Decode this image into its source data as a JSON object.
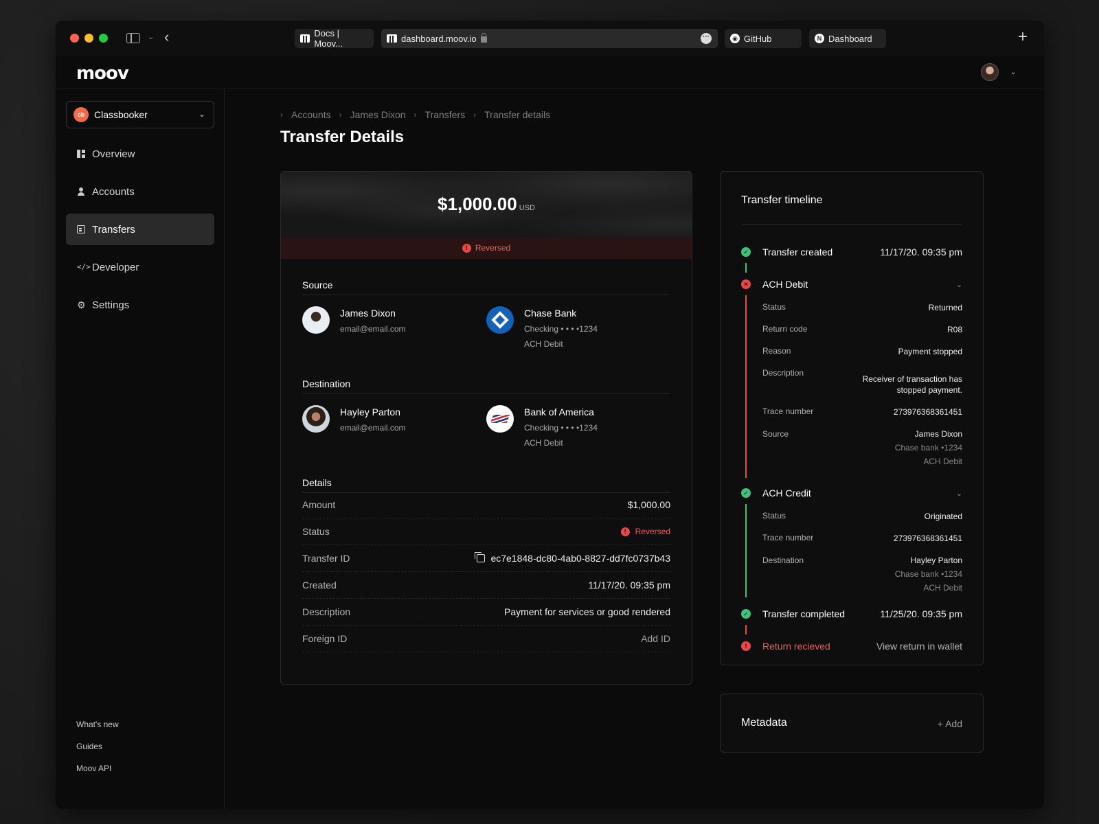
{
  "browser": {
    "tabs": [
      {
        "label": "Docs | Moov..."
      },
      {
        "label": "dashboard.moov.io"
      },
      {
        "label": "GitHub"
      },
      {
        "label": "Dashboard"
      }
    ]
  },
  "app": {
    "logo": "moov"
  },
  "sidebar": {
    "org": {
      "badge": "cb",
      "name": "Classbooker"
    },
    "items": [
      {
        "label": "Overview",
        "icon": "grid-icon"
      },
      {
        "label": "Accounts",
        "icon": "user-icon"
      },
      {
        "label": "Transfers",
        "icon": "document-icon",
        "active": true
      },
      {
        "label": "Developer",
        "icon": "code-icon"
      },
      {
        "label": "Settings",
        "icon": "gear-icon"
      }
    ],
    "footer": [
      "What's new",
      "Guides",
      "Moov API"
    ]
  },
  "breadcrumb": [
    "Accounts",
    "James Dixon",
    "Transfers",
    "Transfer details"
  ],
  "page_title": "Transfer Details",
  "transfer": {
    "amount": "$1,000.00",
    "currency": "USD",
    "status": "Reversed",
    "source_heading": "Source",
    "source": {
      "name": "James Dixon",
      "email": "email@email.com",
      "bank": "Chase Bank",
      "account": "Checking • • • •1234",
      "method": "ACH Debit"
    },
    "destination_heading": "Destination",
    "destination": {
      "name": "Hayley Parton",
      "email": "email@email.com",
      "bank": "Bank of America",
      "account": "Checking • • • •1234",
      "method": "ACH Debit"
    },
    "details_heading": "Details",
    "details": [
      {
        "key": "Amount",
        "value": "$1,000.00"
      },
      {
        "key": "Status",
        "value": "Reversed"
      },
      {
        "key": "Transfer ID",
        "value": "ec7e1848-dc80-4ab0-8827-dd7fc0737b43"
      },
      {
        "key": "Created",
        "value": "11/17/20. 09:35 pm"
      },
      {
        "key": "Description",
        "value": "Payment for services or good rendered"
      },
      {
        "key": "Foreign ID",
        "value": "Add ID"
      }
    ]
  },
  "timeline": {
    "title": "Transfer timeline",
    "created": {
      "label": "Transfer created",
      "time": "11/17/20. 09:35 pm"
    },
    "debit": {
      "label": "ACH Debit",
      "rows": [
        {
          "key": "Status",
          "value": "Returned"
        },
        {
          "key": "Return code",
          "value": "R08"
        },
        {
          "key": "Reason",
          "value": "Payment stopped"
        },
        {
          "key": "Description",
          "value": "Receiver of transaction has stopped payment."
        },
        {
          "key": "Trace number",
          "value": "273976368361451"
        }
      ],
      "source_key": "Source",
      "source_lines": [
        "James Dixon",
        "Chase bank •1234",
        "ACH Debit"
      ]
    },
    "credit": {
      "label": "ACH Credit",
      "rows": [
        {
          "key": "Status",
          "value": "Originated"
        },
        {
          "key": "Trace number",
          "value": "273976368361451"
        }
      ],
      "dest_key": "Destination",
      "dest_lines": [
        "Hayley Parton",
        "Chase bank •1234",
        "ACH Debit"
      ]
    },
    "completed": {
      "label": "Transfer completed",
      "time": "11/25/20. 09:35 pm"
    },
    "returned": {
      "label": "Return recieved",
      "link": "View return in wallet"
    }
  },
  "metadata": {
    "title": "Metadata",
    "add": "+ Add"
  },
  "colors": {
    "success": "#3ec27c",
    "error": "#e84848",
    "brand": "#f26a4a"
  }
}
